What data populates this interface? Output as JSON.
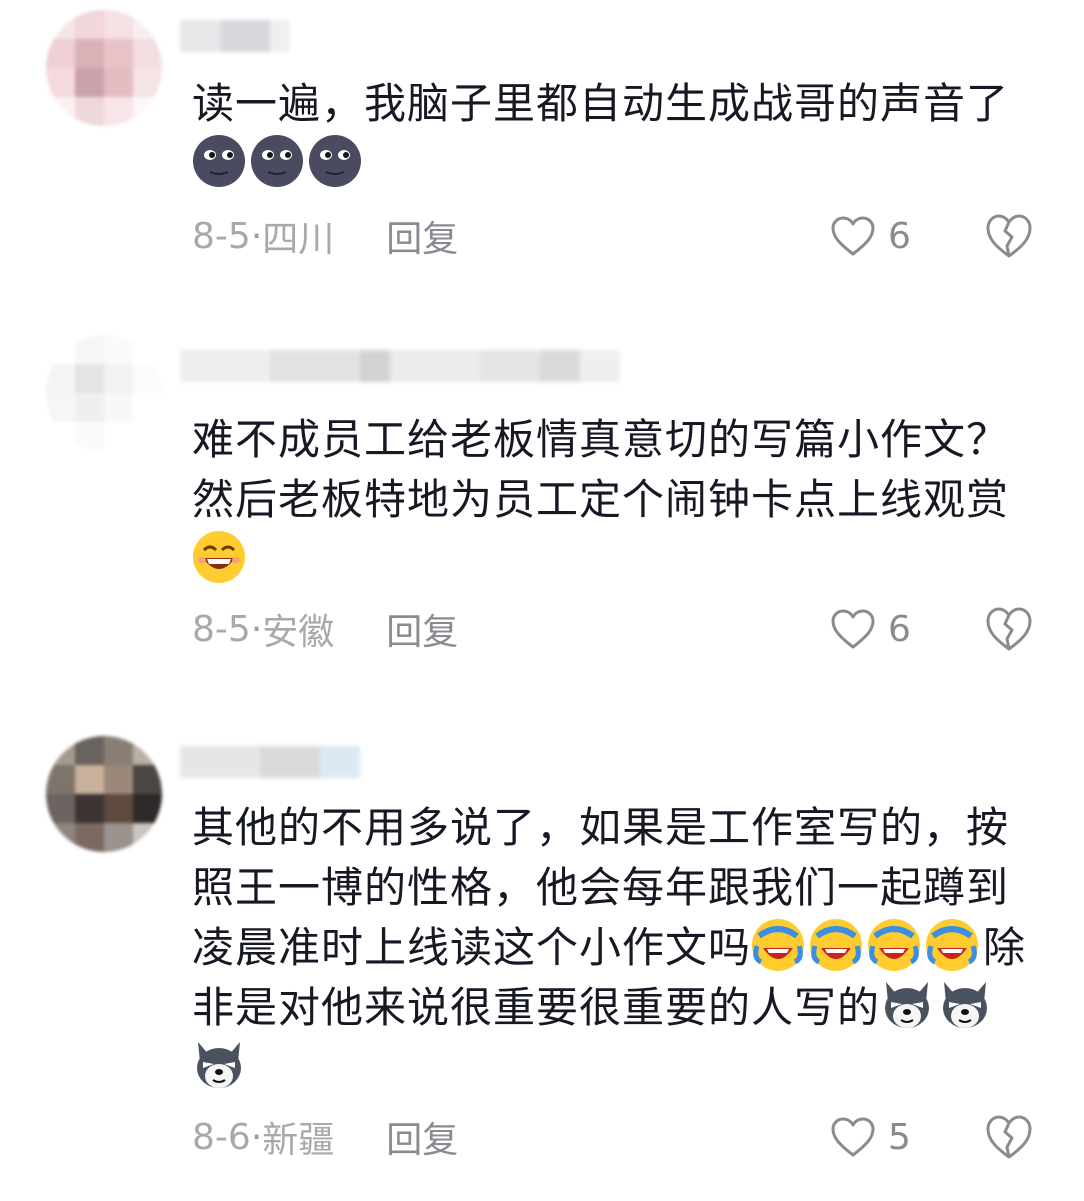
{
  "comments": [
    {
      "text": "读一遍，我脑子里都自动生成战哥的声音了",
      "emojis": [
        "moon-face",
        "moon-face",
        "moon-face"
      ],
      "date": "8-5",
      "location": "四川",
      "reply_label": "回复",
      "likes": "6"
    },
    {
      "text": "难不成员工给老板情真意切的写篇小作文？然后老板特地为员工定个闹钟卡点上线观赏",
      "emojis": [
        "grin-face"
      ],
      "date": "8-5",
      "location": "安徽",
      "reply_label": "回复",
      "likes": "6"
    },
    {
      "text_a": "其他的不用多说了，如果是工作室写的，按照王一博的性格，他会每年跟我们一起蹲到凌晨准时上线读这个小作文吗",
      "text_b": "除非是对他来说很重要很重要的人写的",
      "emojis_a": [
        "laugh-cry-face",
        "laugh-cry-face",
        "laugh-cry-face",
        "laugh-cry-face"
      ],
      "emojis_b": [
        "husky-face",
        "husky-face",
        "husky-face"
      ],
      "date": "8-6",
      "location": "新疆",
      "reply_label": "回复",
      "likes": "5"
    }
  ],
  "separator": "·",
  "colors": {
    "text": "#161823",
    "meta": "#9a9ba0",
    "background": "#ffffff"
  }
}
